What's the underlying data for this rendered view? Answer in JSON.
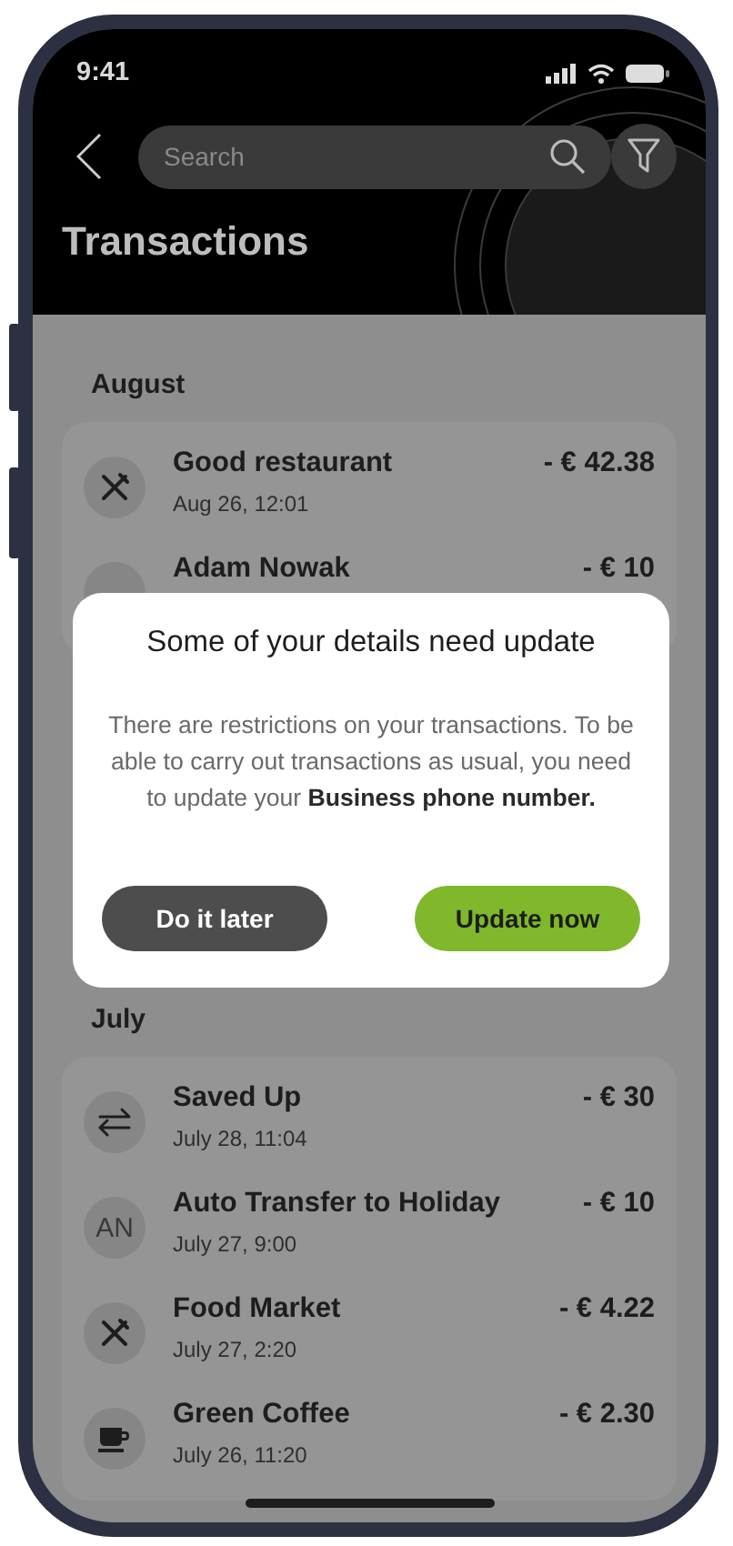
{
  "status_bar": {
    "time": "9:41"
  },
  "header": {
    "search": {
      "placeholder": "Search"
    },
    "title": "Transactions"
  },
  "sections": [
    {
      "heading": "August",
      "transactions": [
        {
          "icon": {
            "kind": "cutlery"
          },
          "name": "Good restaurant",
          "date": "Aug 26, 12:01",
          "amount": "- € 42.38"
        },
        {
          "icon": {
            "kind": "initials"
          },
          "name": "Adam Nowak",
          "amount": "- € 10"
        }
      ]
    },
    {
      "heading": "July",
      "transactions": [
        {
          "icon": {
            "kind": "transfer"
          },
          "name": "Saved Up",
          "date": "July 28, 11:04",
          "amount": "- € 30"
        },
        {
          "icon": {
            "kind": "initials",
            "text": "AN"
          },
          "name": "Auto Transfer to Holiday",
          "date": "July 27, 9:00",
          "amount": "- € 10"
        },
        {
          "icon": {
            "kind": "cutlery"
          },
          "name": "Food Market",
          "date": "July 27, 2:20",
          "amount": "- € 4.22"
        },
        {
          "icon": {
            "kind": "coffee"
          },
          "name": "Green Coffee",
          "date": "July 26, 11:20",
          "amount": "- € 2.30"
        }
      ]
    }
  ],
  "dialog": {
    "title": "Some of your details need update",
    "message": "There are restrictions on your transactions. To be able to carry out transactions as usual, you need to update your **Business phone number.**",
    "buttons": [
      {
        "label": "Do it later",
        "kind": "secondary"
      },
      {
        "label": "Update now",
        "kind": "primary"
      }
    ]
  }
}
